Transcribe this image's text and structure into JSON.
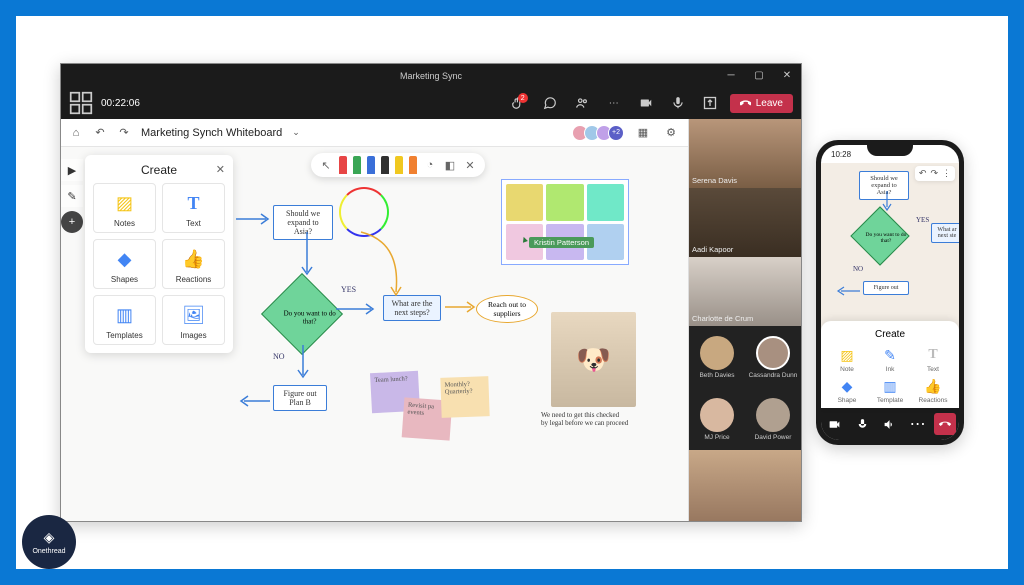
{
  "window": {
    "title": "Marketing Sync",
    "timer": "00:22:06"
  },
  "meeting_bar": {
    "reaction_badge": "2",
    "leave_label": "Leave"
  },
  "whiteboard": {
    "title": "Marketing Synch Whiteboard",
    "avatars_plus": "+2",
    "cursor_name": "Kristin Patterson",
    "nodes": {
      "shouldExpand": "Should we\nexpand to Asia?",
      "wantDoThat": "Do you want\nto do that?",
      "yes": "YES",
      "no": "NO",
      "nextSteps": "What are the\nnext steps?",
      "reachOut": "Reach out to\nsuppliers",
      "planB": "Figure out\nPlan B"
    },
    "sticky": {
      "teamLunch": "Team lunch?",
      "revisit": "Revisit pa\nevents",
      "monthly": "Monthly?\nQuarterly?"
    },
    "dog_caption": "We need to get this checked\nby legal before we can proceed",
    "pen_colors": {
      "red": "#e74545",
      "green": "#3aa655",
      "blue": "#3a6fd8",
      "black": "#303030",
      "yellow": "#f0c820",
      "orange": "#f08030"
    }
  },
  "create_panel": {
    "title": "Create",
    "items": {
      "notes": "Notes",
      "text": "Text",
      "shapes": "Shapes",
      "reactions": "Reactions",
      "templates": "Templates",
      "images": "Images"
    }
  },
  "participants": {
    "large": [
      {
        "name": "Serena Davis"
      },
      {
        "name": "Aadi Kapoor"
      },
      {
        "name": "Charlotte de Crum"
      }
    ],
    "small": [
      {
        "name": "Beth Davies"
      },
      {
        "name": "Cassandra Dunn"
      },
      {
        "name": "MJ Price"
      },
      {
        "name": "David Power"
      }
    ]
  },
  "mobile": {
    "time": "10:28",
    "create_title": "Create",
    "items": {
      "note": "Note",
      "ink": "Ink",
      "text": "Text",
      "shape": "Shape",
      "template": "Template",
      "reactions": "Reactions"
    },
    "nodes": {
      "shouldExpand": "Should we\nexpand to Asia?",
      "wantDoThat": "Do you want\nto do that?",
      "yes": "YES",
      "no": "NO",
      "nextSteps": "What ar\nnext ste",
      "planB": "Figure out"
    }
  },
  "branding": {
    "name": "Onethread"
  }
}
